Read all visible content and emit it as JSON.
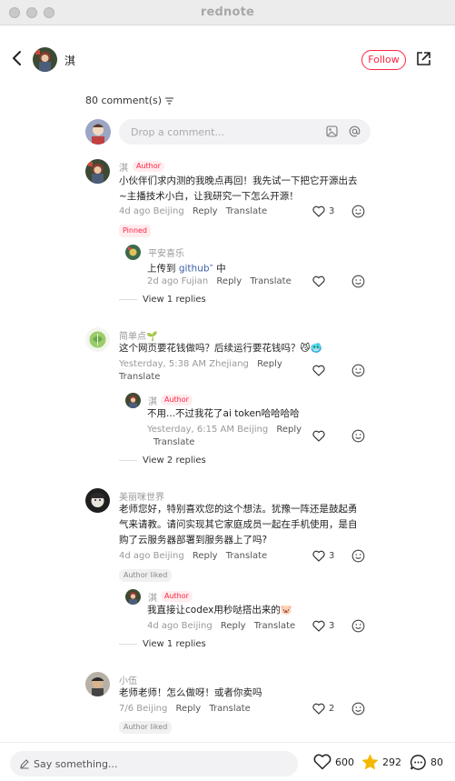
{
  "window": {
    "title": "rednote"
  },
  "header": {
    "author_name": "淇",
    "follow_label": "Follow"
  },
  "comments_header": {
    "count_label": "80 comment(s)"
  },
  "input": {
    "placeholder": "Drop a comment..."
  },
  "comments": [
    {
      "name": "淇",
      "tag": "Author",
      "text_lines": [
        "小伙伴们求内测的我晚点再回！我先试一下把它开源出去",
        "~主播技术小白，让我研究一下怎么开源！"
      ],
      "meta": "4d ago Beijing",
      "reply": "Reply",
      "translate": "Translate",
      "likes": "3",
      "badge": "Pinned",
      "reply_item": {
        "name": "平安喜乐",
        "text_pre": "上传到",
        "link": "github",
        "text_post": "中",
        "meta": "2d ago Fujian",
        "reply": "Reply",
        "translate": "Translate"
      },
      "view_replies": "View 1 replies"
    },
    {
      "name": "简单点🌱",
      "text_lines": [
        "这个网页要花钱做吗？后续运行要花钱吗？😼🥶"
      ],
      "meta": "Yesterday, 5:38 AM Zhejiang",
      "reply": "Reply",
      "translate": "Translate",
      "reply_item": {
        "name": "淇",
        "tag": "Author",
        "text": "不用...不过我花了ai token哈哈哈哈",
        "meta": "Yesterday, 6:15 AM Beijing",
        "reply": "Reply",
        "translate": "Translate"
      },
      "view_replies": "View 2 replies"
    },
    {
      "name": "美丽咪世界",
      "text_lines": [
        "老师您好，特别喜欢您的这个想法。犹豫一阵还是鼓起勇",
        "气来请教。请问实现其它家庭成员一起在手机使用，是自",
        "购了云服务器部署到服务器上了吗?"
      ],
      "meta": "4d ago Beijing",
      "reply": "Reply",
      "translate": "Translate",
      "likes": "3",
      "badge": "Author liked",
      "reply_item": {
        "name": "淇",
        "tag": "Author",
        "text": "我直接让codex用秒哒搭出来的🐷",
        "meta": "4d ago Beijing",
        "reply": "Reply",
        "translate": "Translate",
        "likes": "3"
      },
      "view_replies": "View 1 replies"
    },
    {
      "name": "小伍",
      "text_lines": [
        "老师老师！怎么做呀！或者你卖吗"
      ],
      "meta": "7/6 Beijing",
      "reply": "Reply",
      "translate": "Translate",
      "likes": "2",
      "badge": "Author liked"
    }
  ],
  "bottom": {
    "placeholder": "Say something...",
    "likes": "600",
    "stars": "292",
    "comments": "80"
  },
  "colors": {
    "accent": "#ff2442",
    "star": "#f5b800"
  }
}
